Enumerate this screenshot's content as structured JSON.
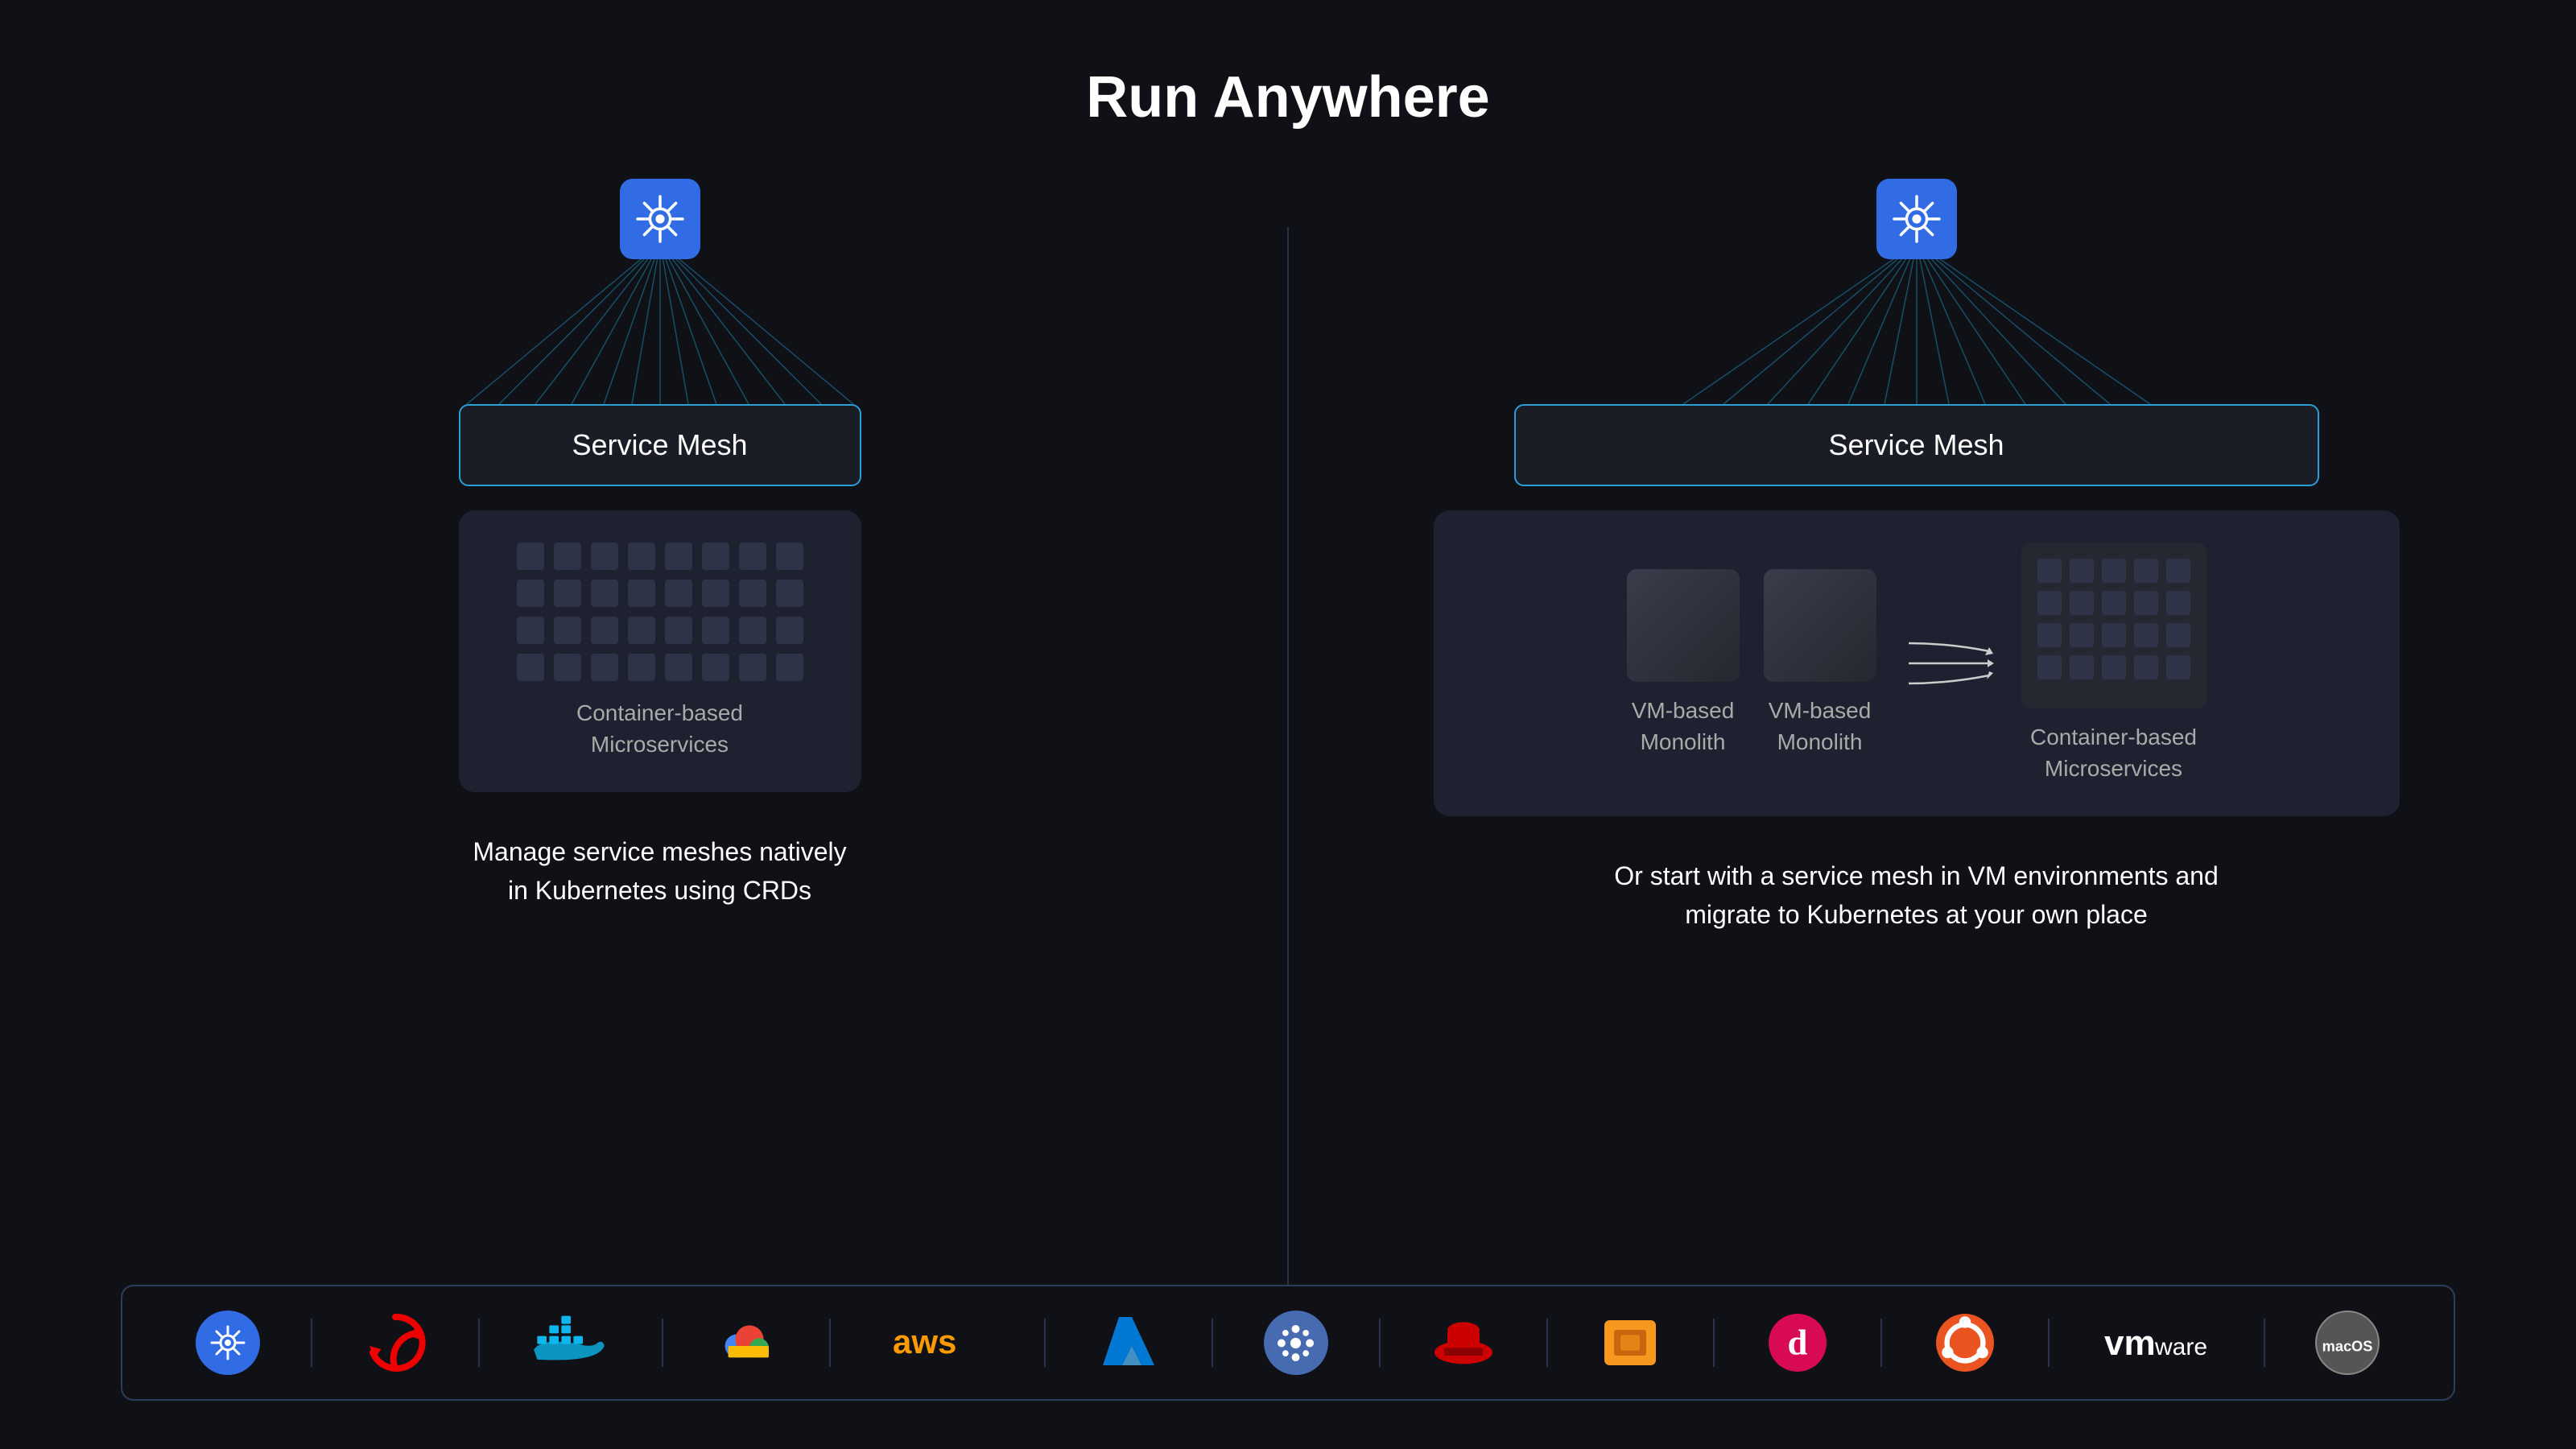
{
  "page": {
    "title": "Run Anywhere",
    "background": "#0f1117"
  },
  "left_panel": {
    "service_mesh_label": "Service Mesh",
    "container_label": "Container-based\nMicroservices",
    "description": "Manage service meshes natively\nin Kubernetes using CRDs"
  },
  "right_panel": {
    "service_mesh_label": "Service Mesh",
    "vm_box1_label": "VM-based\nMonolith",
    "vm_box2_label": "VM-based\nMonolith",
    "container_label": "Container-based\nMicroservices",
    "description": "Or start with a service mesh in VM environments and\nmigrate to Kubernetes at your own place"
  },
  "logos": [
    {
      "name": "kubernetes",
      "type": "k8s"
    },
    {
      "name": "openshift",
      "type": "openshift"
    },
    {
      "name": "docker",
      "type": "docker"
    },
    {
      "name": "gcp",
      "type": "gcp"
    },
    {
      "name": "aws",
      "type": "aws"
    },
    {
      "name": "azure",
      "type": "azure"
    },
    {
      "name": "istio",
      "type": "istio"
    },
    {
      "name": "redhat",
      "type": "redhat"
    },
    {
      "name": "box",
      "type": "box"
    },
    {
      "name": "debian",
      "type": "debian"
    },
    {
      "name": "ubuntu",
      "type": "ubuntu"
    },
    {
      "name": "vmware",
      "type": "vmware"
    },
    {
      "name": "macos",
      "type": "macos"
    }
  ],
  "icons": {
    "k8s_color": "#326ce5",
    "network_line_color": "#1a6a8a"
  }
}
